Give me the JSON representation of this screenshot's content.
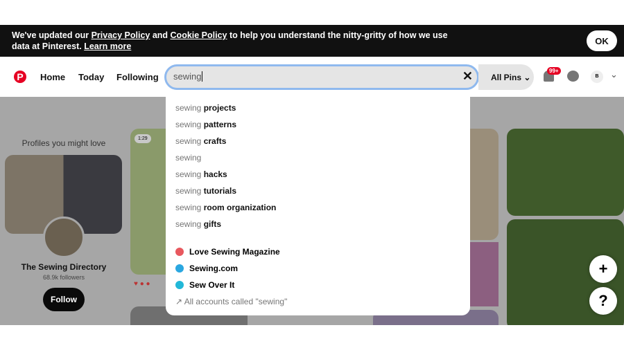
{
  "banner": {
    "t1": "We've updated our ",
    "privacy": "Privacy Policy",
    "t2": " and ",
    "cookie": "Cookie Policy",
    "t3": " to help you understand the nitty-gritty of how we use",
    "t4": "data at Pinterest. ",
    "learn": "Learn more",
    "ok": "OK"
  },
  "header": {
    "logo": "P",
    "nav": [
      "Home",
      "Today",
      "Following"
    ],
    "search_value": "sewing",
    "clear": "✕",
    "scope": "All Pins",
    "badge": "99+",
    "avatar": "B"
  },
  "suggestions": [
    {
      "q": "sewing",
      "b": " projects"
    },
    {
      "q": "sewing",
      "b": " patterns"
    },
    {
      "q": "sewing",
      "b": " crafts"
    },
    {
      "q": "sewing",
      "b": ""
    },
    {
      "q": "sewing",
      "b": " hacks"
    },
    {
      "q": "sewing",
      "b": " tutorials"
    },
    {
      "q": "sewing",
      "b": " room organization"
    },
    {
      "q": "sewing",
      "b": " gifts"
    }
  ],
  "accounts": [
    {
      "name": "Love Sewing Magazine",
      "color": "#e8585e"
    },
    {
      "name": "Sewing.com",
      "color": "#2aa7e0"
    },
    {
      "name": "Sew Over It",
      "color": "#22b8d8"
    }
  ],
  "all_accounts": "All accounts called \"sewing\"",
  "profiles": {
    "heading": "Profiles you might love",
    "name": "The Sewing Directory",
    "followers": "68.9k followers",
    "follow": "Follow"
  },
  "pin": {
    "duration": "1:29"
  },
  "fab": {
    "add": "+",
    "help": "?"
  }
}
